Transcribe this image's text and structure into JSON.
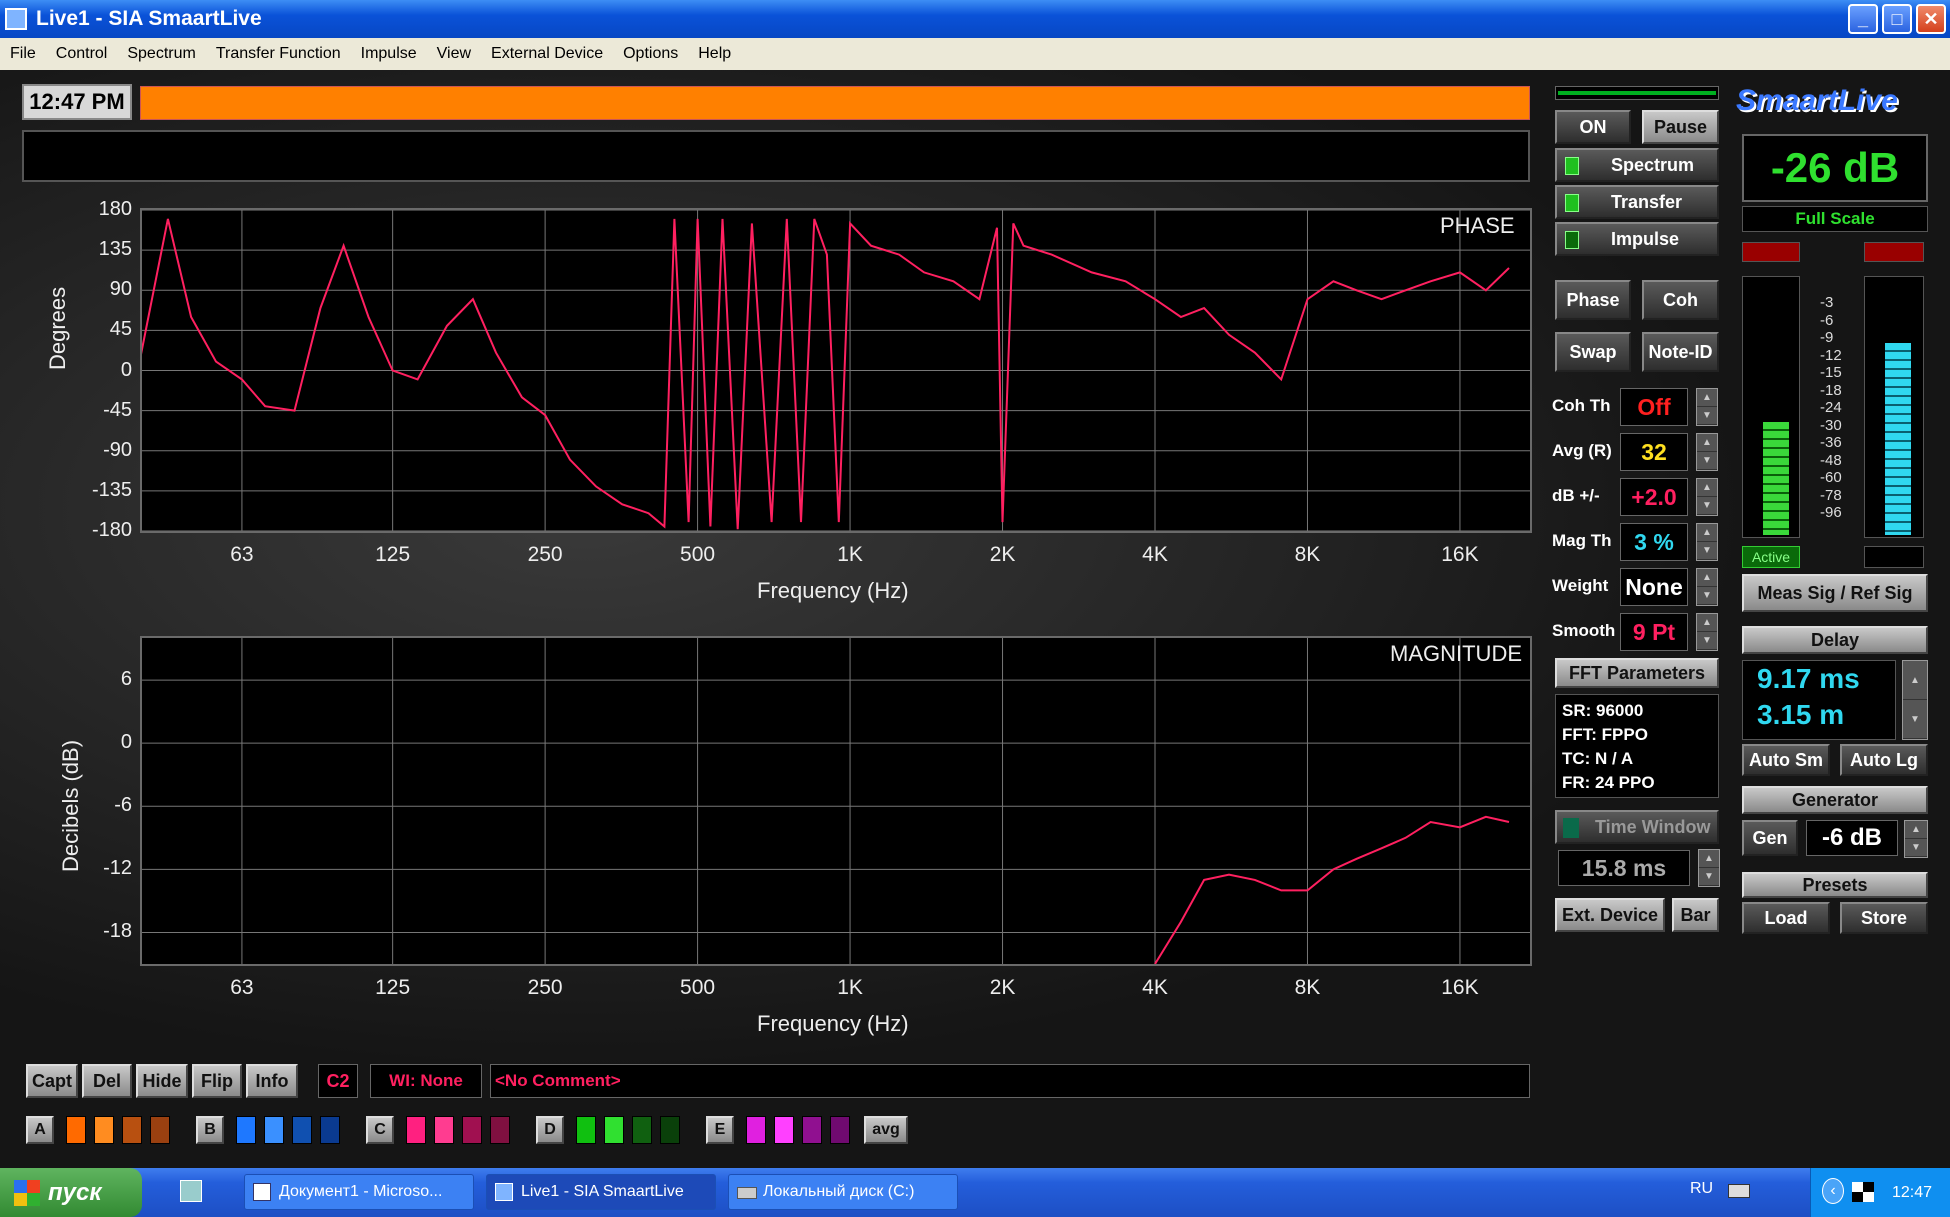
{
  "window": {
    "title": "Live1 - SIA SmaartLive",
    "controls": [
      "_",
      "□",
      "✕"
    ]
  },
  "menu": [
    "File",
    "Control",
    "Spectrum",
    "Transfer Function",
    "Impulse",
    "View",
    "External Device",
    "Options",
    "Help"
  ],
  "clock": "12:47 PM",
  "phase_plot": {
    "label": "PHASE",
    "ylabel": "Degrees",
    "xlabel": "Frequency (Hz)",
    "yticks": [
      "180",
      "135",
      "90",
      "45",
      "0",
      "-45",
      "-90",
      "-135",
      "-180"
    ],
    "xticks": [
      "63",
      "125",
      "250",
      "500",
      "1K",
      "2K",
      "4K",
      "8K",
      "16K"
    ],
    "trace_color": "#ff2060"
  },
  "magnitude_plot": {
    "label": "MAGNITUDE",
    "ylabel": "Decibels (dB)",
    "xlabel": "Frequency (Hz)",
    "yticks": [
      "6",
      "0",
      "-6",
      "-12",
      "-18"
    ],
    "xticks": [
      "63",
      "125",
      "250",
      "500",
      "1K",
      "2K",
      "4K",
      "8K",
      "16K"
    ],
    "trace_color": "#ff2060"
  },
  "chart_data": [
    {
      "type": "line",
      "title": "PHASE",
      "xlabel": "Frequency (Hz)",
      "ylabel": "Degrees",
      "xscale": "log",
      "ylim": [
        -180,
        180
      ],
      "x": [
        20,
        25,
        32,
        38,
        45,
        50,
        56,
        63,
        70,
        80,
        90,
        100,
        112,
        125,
        140,
        160,
        180,
        200,
        225,
        250,
        280,
        315,
        355,
        400,
        430,
        450,
        480,
        500,
        530,
        560,
        600,
        640,
        700,
        750,
        800,
        850,
        900,
        950,
        1000,
        1100,
        1250,
        1400,
        1600,
        1800,
        1950,
        2000,
        2100,
        2200,
        2500,
        3000,
        3500,
        4000,
        4500,
        5000,
        5600,
        6300,
        7100,
        8000,
        9000,
        10000,
        11200,
        12500,
        14000,
        16000,
        18000,
        20000
      ],
      "y": [
        -100,
        -130,
        -50,
        -40,
        170,
        60,
        10,
        -10,
        -40,
        -45,
        70,
        140,
        60,
        0,
        -10,
        50,
        80,
        20,
        -30,
        -50,
        -100,
        -130,
        -150,
        -160,
        -175,
        170,
        -170,
        170,
        -175,
        170,
        -178,
        165,
        -170,
        170,
        -170,
        170,
        130,
        -170,
        165,
        140,
        130,
        110,
        100,
        80,
        160,
        -170,
        165,
        140,
        130,
        110,
        100,
        80,
        60,
        70,
        40,
        20,
        -10,
        80,
        100,
        90,
        80,
        90,
        100,
        110,
        90,
        115
      ]
    },
    {
      "type": "line",
      "title": "MAGNITUDE",
      "xlabel": "Frequency (Hz)",
      "ylabel": "Decibels (dB)",
      "xscale": "log",
      "ylim": [
        -21,
        10
      ],
      "x": [
        4000,
        4500,
        5000,
        5600,
        6300,
        7100,
        8000,
        9000,
        10000,
        11200,
        12500,
        14000,
        16000,
        18000,
        20000
      ],
      "y": [
        -21,
        -17,
        -13,
        -12.5,
        -13,
        -14,
        -14,
        -12,
        -11,
        -10,
        -9,
        -7.5,
        -8,
        -7,
        -7.5
      ]
    }
  ],
  "side_panel": {
    "on": "ON",
    "pause": "Pause",
    "spectrum": "Spectrum",
    "transfer": "Transfer",
    "impulse": "Impulse",
    "phase": "Phase",
    "coh": "Coh",
    "swap": "Swap",
    "note_id": "Note-ID",
    "coh_th": {
      "label": "Coh Th",
      "value": "Off"
    },
    "avg": {
      "label": "Avg (R)",
      "value": "32"
    },
    "db": {
      "label": "dB +/-",
      "value": "+2.0"
    },
    "mag_th": {
      "label": "Mag Th",
      "value": "3 %"
    },
    "weight": {
      "label": "Weight",
      "value": "None"
    },
    "smooth": {
      "label": "Smooth",
      "value": "9 Pt"
    },
    "fft_params": {
      "title": "FFT Parameters",
      "lines": [
        "SR: 96000",
        "FFT: FPPO",
        "TC: N / A",
        "FR: 24 PPO"
      ]
    },
    "time_window": "Time Window",
    "time_value": "15.8 ms",
    "ext_device": "Ext. Device",
    "bar": "Bar"
  },
  "right_panel": {
    "logo": "SmaartLive",
    "level": "-26 dB",
    "full_scale": "Full Scale",
    "meter_scale": [
      "-3",
      "-6",
      "-9",
      "-12",
      "-15",
      "-18",
      "-24",
      "-30",
      "-36",
      "-48",
      "-60",
      "-78",
      "-96"
    ],
    "meter_left_fill": 0.44,
    "meter_right_fill": 0.75,
    "active": "Active",
    "meas_ref": "Meas Sig / Ref Sig",
    "delay_title": "Delay",
    "delay_ms": "9.17 ms",
    "delay_m": "3.15 m",
    "auto_sm": "Auto Sm",
    "auto_lg": "Auto Lg",
    "generator": "Generator",
    "gen": "Gen",
    "gen_level": "-6 dB",
    "presets": "Presets",
    "load": "Load",
    "store": "Store"
  },
  "bottom": {
    "capt": "Capt",
    "del": "Del",
    "hide": "Hide",
    "flip": "Flip",
    "info": "Info",
    "c2": "C2",
    "wi": "WI: None",
    "comment": "<No Comment>",
    "groups": [
      {
        "letter": "A",
        "colors": [
          "#ff6a00",
          "#ff8c20",
          "#b85010",
          "#9a4010"
        ]
      },
      {
        "letter": "B",
        "colors": [
          "#1e78ff",
          "#3a90ff",
          "#1050b0",
          "#0a3a90"
        ]
      },
      {
        "letter": "C",
        "colors": [
          "#ff2080",
          "#ff3c90",
          "#a01050",
          "#801040"
        ]
      },
      {
        "letter": "D",
        "colors": [
          "#10c010",
          "#30e030",
          "#106010",
          "#0a400a"
        ]
      },
      {
        "letter": "E",
        "colors": [
          "#e020e0",
          "#ff40ff",
          "#901090",
          "#700a70"
        ]
      }
    ],
    "avg": "avg"
  },
  "taskbar": {
    "start": "пуск",
    "tasks": [
      "Документ1 - Microso...",
      "Live1 - SIA SmaartLive",
      "Локальный диск (C:)"
    ],
    "lang": "RU",
    "time": "12:47"
  }
}
